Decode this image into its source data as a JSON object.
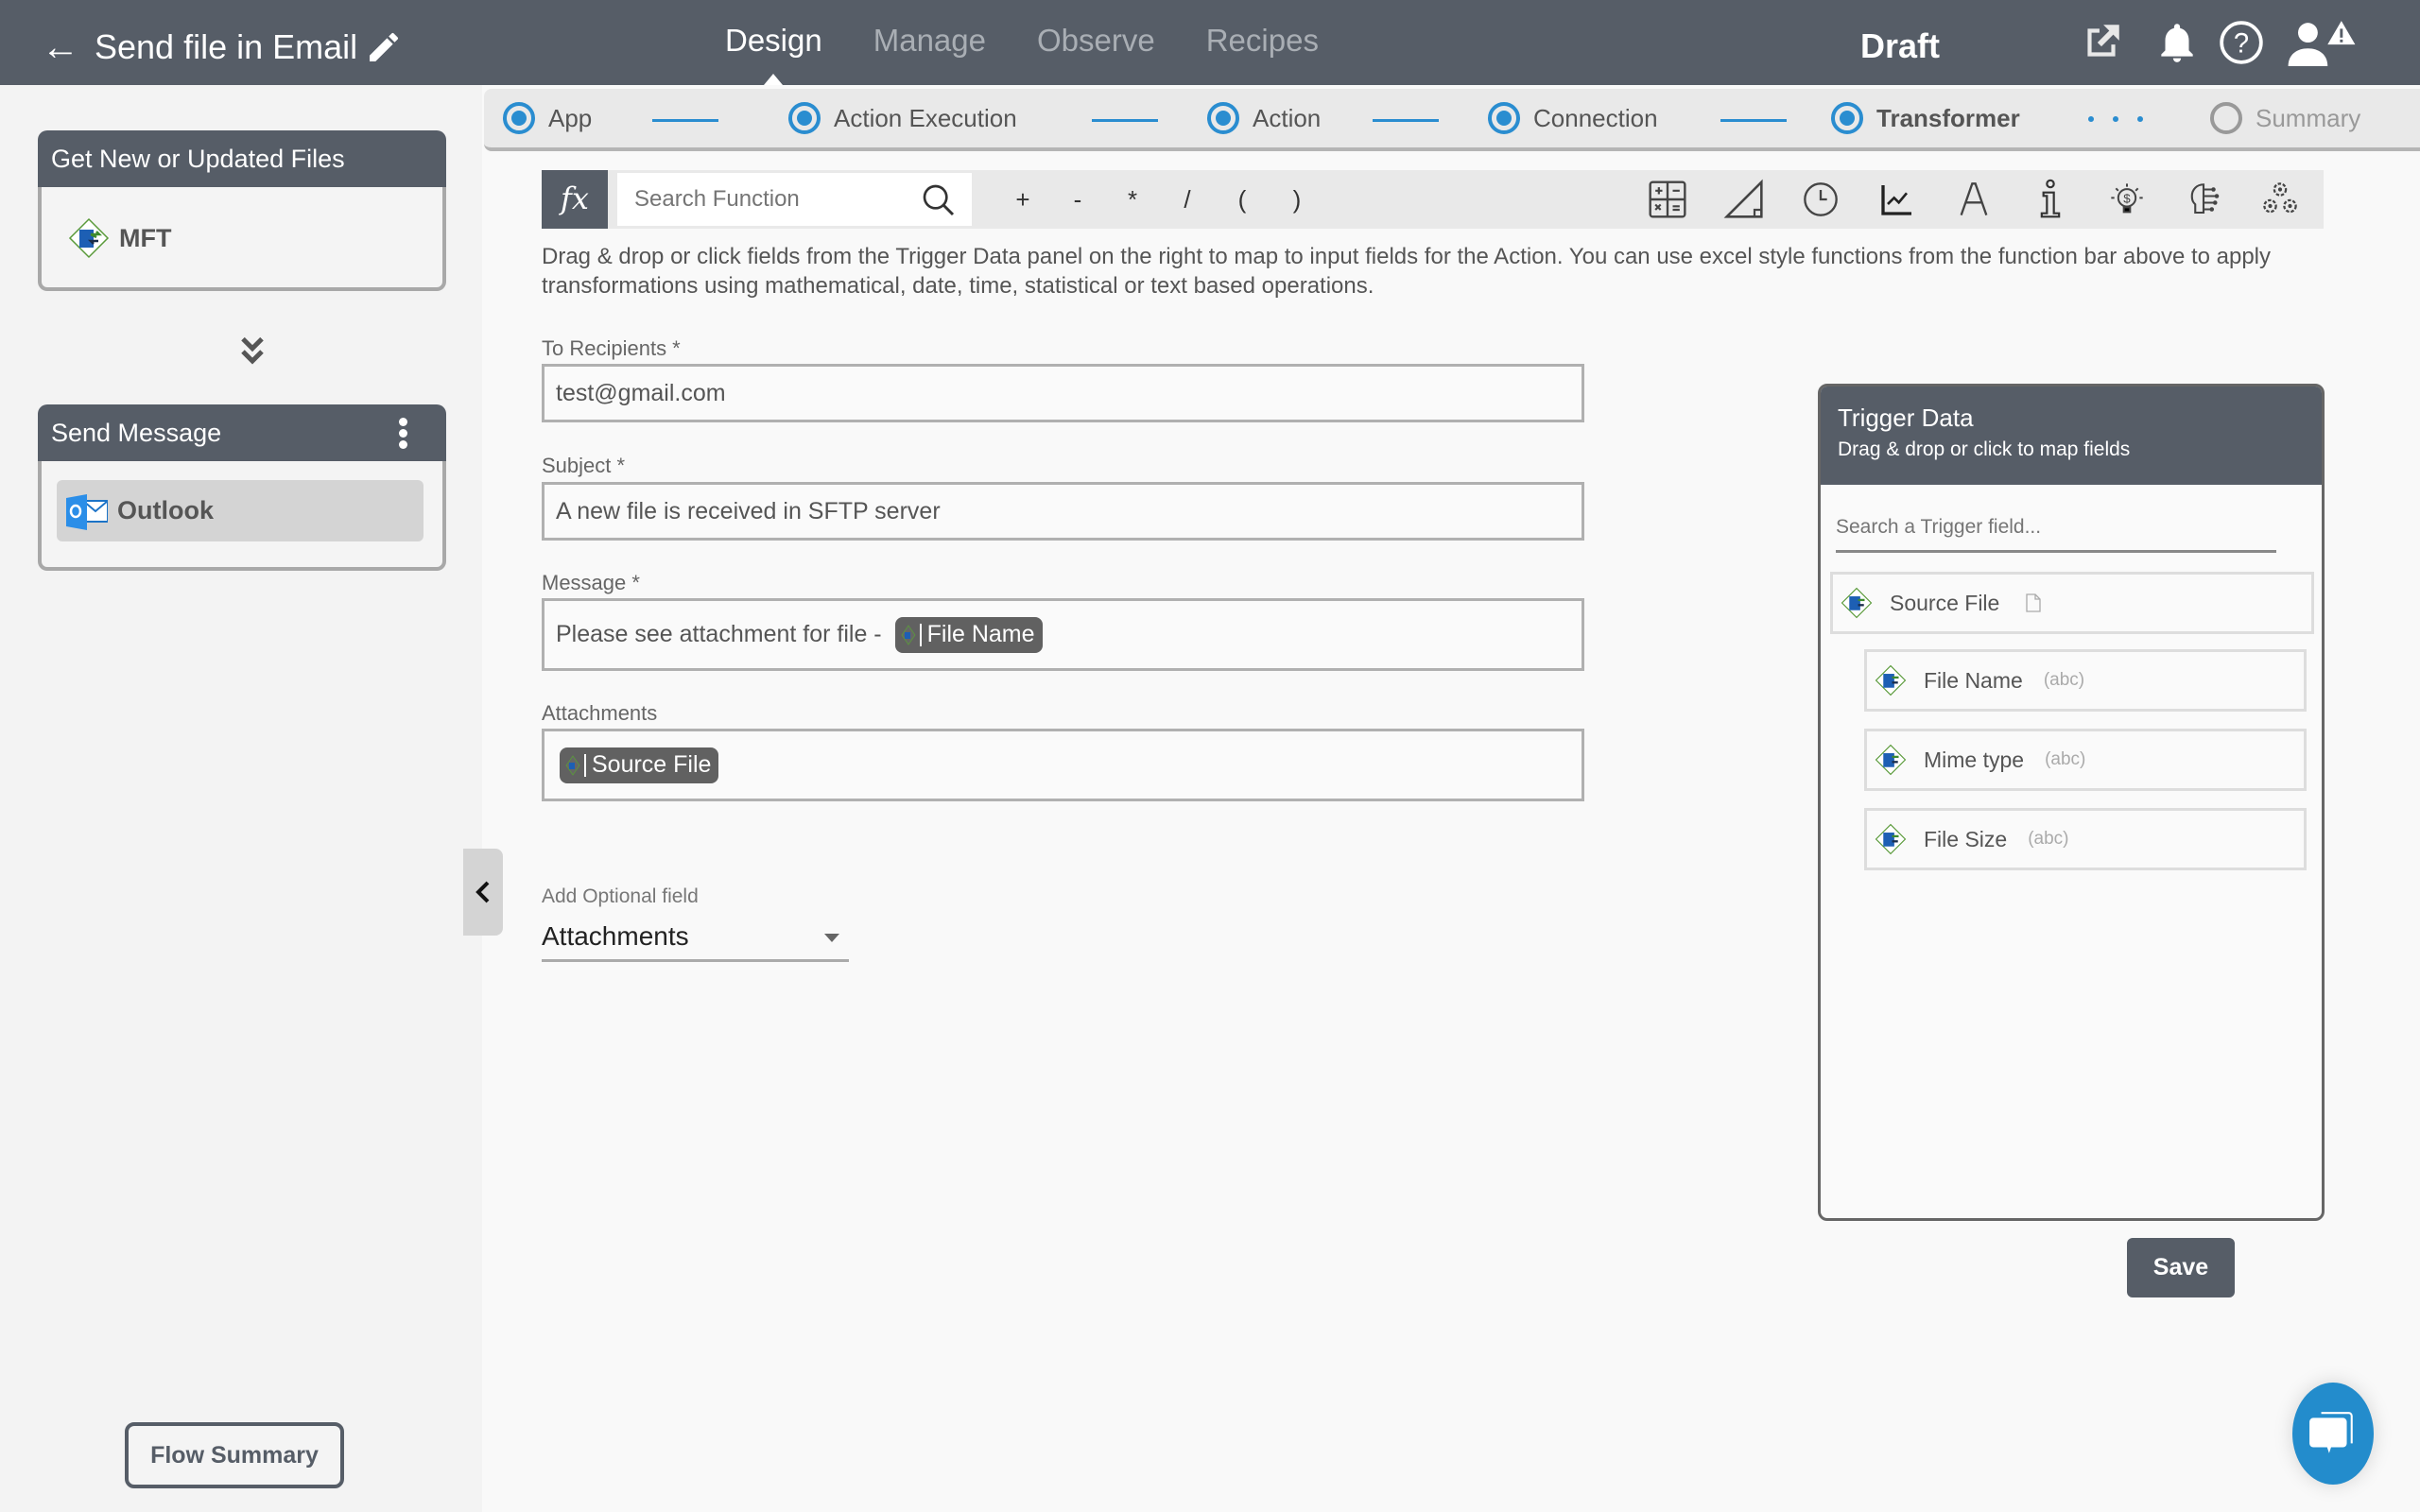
{
  "header": {
    "back_icon": "arrow-left-icon",
    "title": "Send file in Email",
    "edit_icon": "pencil-icon",
    "tabs": [
      {
        "label": "Design",
        "active": true
      },
      {
        "label": "Manage",
        "active": false
      },
      {
        "label": "Observe",
        "active": false
      },
      {
        "label": "Recipes",
        "active": false
      }
    ],
    "status": "Draft",
    "icons": [
      "external-link-icon",
      "bell-icon",
      "help-icon",
      "user-alert-icon"
    ]
  },
  "sidebar": {
    "trigger_card": {
      "title": "Get New or Updated Files",
      "app": "MFT"
    },
    "action_card": {
      "title": "Send Message",
      "app": "Outlook"
    },
    "flow_summary_label": "Flow Summary"
  },
  "steps": [
    {
      "label": "App",
      "state": "done"
    },
    {
      "label": "Action Execution",
      "state": "done"
    },
    {
      "label": "Action",
      "state": "done"
    },
    {
      "label": "Connection",
      "state": "done"
    },
    {
      "label": "Transformer",
      "state": "current"
    },
    {
      "label": "Summary",
      "state": "pending"
    }
  ],
  "function_bar": {
    "fx_label": "fx",
    "search_placeholder": "Search Function",
    "operators": [
      "+",
      "-",
      "*",
      "/",
      "(",
      ")"
    ],
    "category_icons": [
      "calculator-icon",
      "triangle-ruler-icon",
      "clock-icon",
      "line-chart-icon",
      "text-a-icon",
      "info-icon",
      "lightbulb-dollar-icon",
      "brain-ai-icon",
      "gears-icon"
    ]
  },
  "description": "Drag & drop or click fields from the Trigger Data panel on the right to map to input fields for the Action. You can use excel style functions from the function bar above to apply transformations using mathematical, date, time, statistical or text based operations.",
  "form": {
    "to": {
      "label": "To Recipients *",
      "value": "test@gmail.com"
    },
    "subject": {
      "label": "Subject *",
      "value": "A new file is received in SFTP server"
    },
    "message": {
      "label": "Message *",
      "text": "Please see attachment for file -",
      "pill": "File Name"
    },
    "attachments": {
      "label": "Attachments",
      "pill": "Source File"
    },
    "optional": {
      "label": "Add Optional field",
      "selected": "Attachments"
    }
  },
  "trigger_data": {
    "title": "Trigger Data",
    "subtitle": "Drag & drop or click to map fields",
    "search_placeholder": "Search a Trigger field...",
    "parent": {
      "name": "Source File"
    },
    "children": [
      {
        "name": "File Name",
        "type": "(abc)"
      },
      {
        "name": "Mime type",
        "type": "(abc)"
      },
      {
        "name": "File Size",
        "type": "(abc)"
      }
    ]
  },
  "save_label": "Save",
  "colors": {
    "header": "#565d67",
    "accent": "#2a8dd0",
    "chat": "#238ccc"
  }
}
